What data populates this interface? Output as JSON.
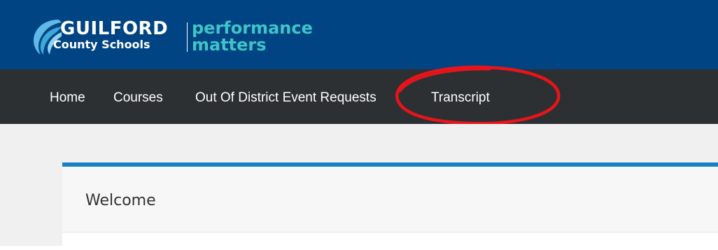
{
  "logo": {
    "line1": "GUILFORD",
    "line2": "County Schools",
    "brand_line1": "performance",
    "brand_line2": "matters",
    "icon": "swoosh-logo-icon"
  },
  "nav": {
    "items": [
      {
        "label": "Home"
      },
      {
        "label": "Courses"
      },
      {
        "label": "Out Of District Event Requests"
      },
      {
        "label": "Transcript"
      }
    ]
  },
  "panel": {
    "title": "Welcome"
  },
  "colors": {
    "header_bg": "#004483",
    "nav_bg": "#2c3033",
    "accent_teal": "#3fc4c9",
    "panel_top_border": "#1b7fc4",
    "annotation_red": "#e8141a"
  }
}
